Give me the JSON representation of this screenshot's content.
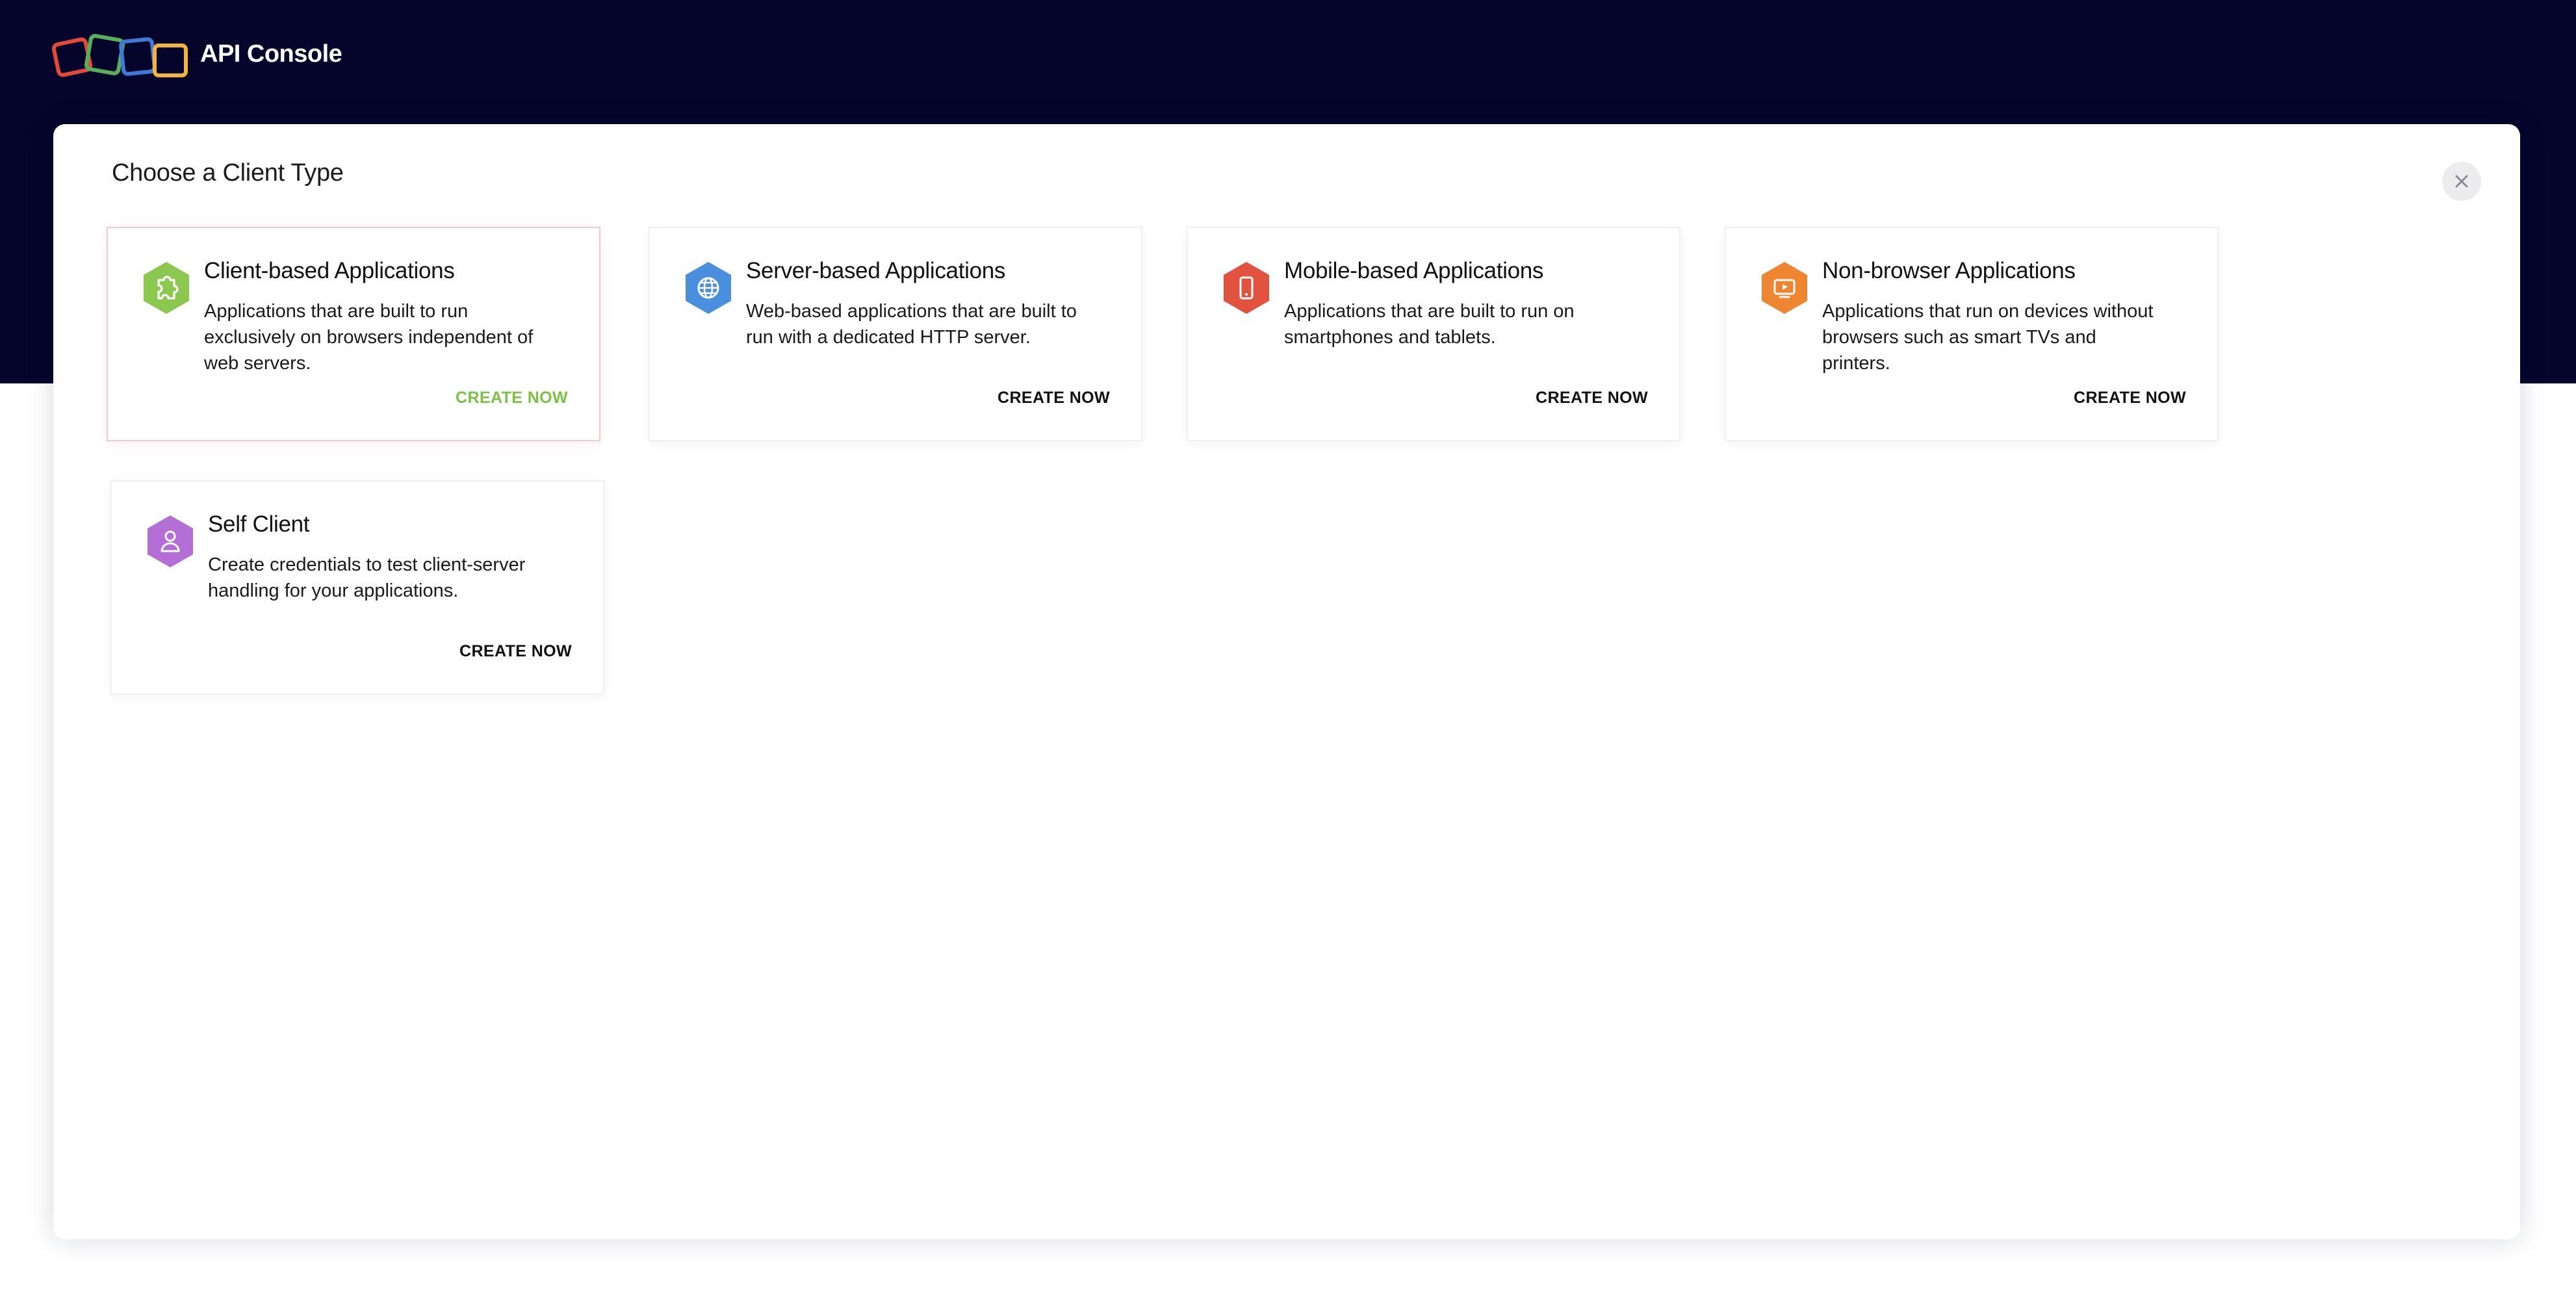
{
  "header": {
    "app_title": "API Console"
  },
  "modal": {
    "title": "Choose a Client Type",
    "close_icon": "close-icon"
  },
  "cards": [
    {
      "title": "Client-based Applications",
      "description": "Applications that are built to run exclusively on browsers independent of web servers.",
      "cta": "CREATE NOW",
      "icon": "puzzle-icon",
      "color": "#8cc850"
    },
    {
      "title": "Server-based Applications",
      "description": "Web-based applications that are built to run with a dedicated HTTP server.",
      "cta": "CREATE NOW",
      "icon": "globe-icon",
      "color": "#4a8fdd"
    },
    {
      "title": "Mobile-based Applications",
      "description": "Applications that are built to run on smartphones and tablets.",
      "cta": "CREATE NOW",
      "icon": "mobile-phone-icon",
      "color": "#e2533f"
    },
    {
      "title": "Non-browser Applications",
      "description": "Applications that run on devices without browsers such as smart TVs and printers.",
      "cta": "CREATE NOW",
      "icon": "tv-icon",
      "color": "#ee8530"
    },
    {
      "title": "Self Client",
      "description": "Create credentials to test client-server handling for your applications.",
      "cta": "CREATE NOW",
      "icon": "user-icon",
      "color": "#b46fd6"
    }
  ],
  "colors": {
    "header_bg": "#05042a",
    "accent_active": "#7cc143",
    "logo_red": "#e24a3b",
    "logo_green": "#56b05a",
    "logo_blue": "#3f7ad6",
    "logo_yellow": "#f2b43a"
  }
}
